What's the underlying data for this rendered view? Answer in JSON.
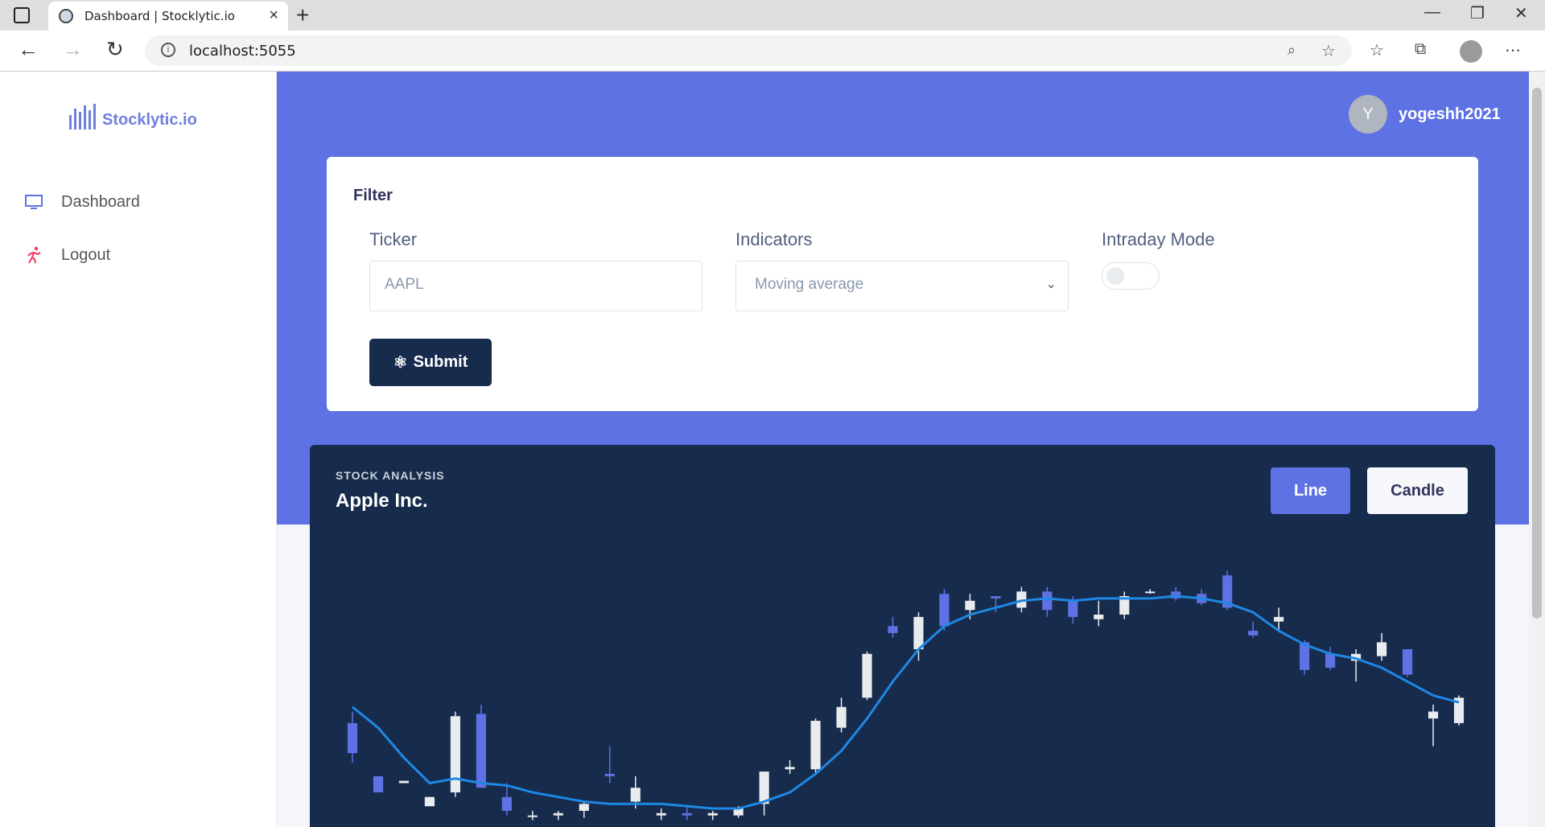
{
  "browser": {
    "tab_title": "Dashboard | Stocklytic.io",
    "url": "localhost:5055"
  },
  "sidebar": {
    "logo_text": "Stocklytic.io",
    "items": [
      {
        "label": "Dashboard",
        "icon": "monitor-icon"
      },
      {
        "label": "Logout",
        "icon": "running-person-icon"
      }
    ]
  },
  "header": {
    "avatar_initial": "Y",
    "username": "yogeshh2021"
  },
  "filter": {
    "title": "Filter",
    "ticker_label": "Ticker",
    "ticker_placeholder": "AAPL",
    "indicators_label": "Indicators",
    "indicators_value": "Moving average",
    "intraday_label": "Intraday Mode",
    "intraday_on": false,
    "submit_label": "Submit"
  },
  "chart_card": {
    "subtitle": "STOCK ANALYSIS",
    "title": "Apple Inc.",
    "line_button": "Line",
    "candle_button": "Candle"
  },
  "colors": {
    "primary": "#5e72e4",
    "dark": "#172b4d",
    "bull_candle": "#e9ecef",
    "bear_candle": "#5e72e4",
    "ma_line": "#1e88e5"
  },
  "chart_data": {
    "type": "candlestick",
    "indicator": "Moving average",
    "candles": [
      {
        "o": 40,
        "h": 45,
        "l": 23,
        "c": 27
      },
      {
        "o": 17,
        "h": 12,
        "l": 26,
        "c": 10
      },
      {
        "o": 14,
        "h": 10,
        "l": 20,
        "c": 15
      },
      {
        "o": 4,
        "h": 0,
        "l": 10,
        "c": 8
      },
      {
        "o": 10,
        "h": 45,
        "l": 8,
        "c": 43
      },
      {
        "o": 44,
        "h": 48,
        "l": 13,
        "c": 12
      },
      {
        "o": 8,
        "h": 14,
        "l": 0,
        "c": 2
      },
      {
        "o": 0,
        "h": 2,
        "l": -2,
        "c": 0
      },
      {
        "o": 0,
        "h": 2,
        "l": -2,
        "c": 1
      },
      {
        "o": 2,
        "h": 6,
        "l": -1,
        "c": 5
      },
      {
        "o": 18,
        "h": 30,
        "l": 14,
        "c": 17
      },
      {
        "o": 6,
        "h": 17,
        "l": 3,
        "c": 12
      },
      {
        "o": 0,
        "h": 3,
        "l": -2,
        "c": 1
      },
      {
        "o": 1,
        "h": 4,
        "l": -2,
        "c": 0
      },
      {
        "o": 0,
        "h": 2,
        "l": -2,
        "c": 1
      },
      {
        "o": 0,
        "h": 4,
        "l": -1,
        "c": 3
      },
      {
        "o": 5,
        "h": 16,
        "l": 0,
        "c": 19
      },
      {
        "o": 20,
        "h": 24,
        "l": 18,
        "c": 21
      },
      {
        "o": 20,
        "h": 42,
        "l": 18,
        "c": 41
      },
      {
        "o": 38,
        "h": 51,
        "l": 36,
        "c": 47
      },
      {
        "o": 51,
        "h": 71,
        "l": 50,
        "c": 70
      },
      {
        "o": 82,
        "h": 86,
        "l": 77,
        "c": 79
      },
      {
        "o": 72,
        "h": 88,
        "l": 67,
        "c": 86
      },
      {
        "o": 96,
        "h": 98,
        "l": 80,
        "c": 82
      },
      {
        "o": 89,
        "h": 96,
        "l": 85,
        "c": 93
      },
      {
        "o": 95,
        "h": 94,
        "l": 88,
        "c": 94
      },
      {
        "o": 90,
        "h": 99,
        "l": 88,
        "c": 97
      },
      {
        "o": 97,
        "h": 99,
        "l": 86,
        "c": 89
      },
      {
        "o": 93,
        "h": 95,
        "l": 83,
        "c": 86
      },
      {
        "o": 85,
        "h": 93,
        "l": 82,
        "c": 87
      },
      {
        "o": 87,
        "h": 97,
        "l": 85,
        "c": 95
      },
      {
        "o": 97,
        "h": 98,
        "l": 96,
        "c": 97
      },
      {
        "o": 97,
        "h": 99,
        "l": 93,
        "c": 94
      },
      {
        "o": 96,
        "h": 98,
        "l": 91,
        "c": 92
      },
      {
        "o": 104,
        "h": 106,
        "l": 89,
        "c": 90
      },
      {
        "o": 80,
        "h": 84,
        "l": 77,
        "c": 78
      },
      {
        "o": 84,
        "h": 90,
        "l": 80,
        "c": 86
      },
      {
        "o": 75,
        "h": 76,
        "l": 61,
        "c": 63
      },
      {
        "o": 70,
        "h": 73,
        "l": 63,
        "c": 64
      },
      {
        "o": 67,
        "h": 72,
        "l": 58,
        "c": 70
      },
      {
        "o": 69,
        "h": 79,
        "l": 67,
        "c": 75
      },
      {
        "o": 72,
        "h": 71,
        "l": 60,
        "c": 61
      },
      {
        "o": 42,
        "h": 48,
        "l": 30,
        "c": 45
      },
      {
        "o": 40,
        "h": 52,
        "l": 39,
        "c": 51
      }
    ],
    "moving_average": [
      47,
      38,
      25,
      14,
      16,
      14,
      13,
      10,
      8,
      6,
      5,
      5,
      5,
      4,
      3,
      3,
      6,
      10,
      18,
      28,
      42,
      58,
      72,
      82,
      87,
      90,
      93,
      94,
      93,
      94,
      94,
      94,
      95,
      94,
      92,
      88,
      80,
      74,
      70,
      68,
      64,
      58,
      52,
      49
    ]
  }
}
